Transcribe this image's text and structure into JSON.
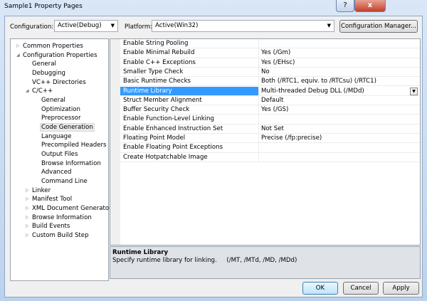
{
  "window": {
    "title": "Sample1 Property Pages",
    "help_glyph": "?",
    "close_glyph": "x"
  },
  "toolbar": {
    "configuration_label": "Configuration:",
    "configuration_value": "Active(Debug)",
    "platform_label": "Platform:",
    "platform_value": "Active(Win32)",
    "config_manager": "Configuration Manager..."
  },
  "tree": [
    {
      "label": "Common Properties",
      "level": 0,
      "expander": "collapsed"
    },
    {
      "label": "Configuration Properties",
      "level": 0,
      "expander": "expanded"
    },
    {
      "label": "General",
      "level": 1
    },
    {
      "label": "Debugging",
      "level": 1
    },
    {
      "label": "VC++ Directories",
      "level": 1
    },
    {
      "label": "C/C++",
      "level": 1,
      "expander": "expanded"
    },
    {
      "label": "General",
      "level": 2
    },
    {
      "label": "Optimization",
      "level": 2
    },
    {
      "label": "Preprocessor",
      "level": 2
    },
    {
      "label": "Code Generation",
      "level": 2,
      "selected": true
    },
    {
      "label": "Language",
      "level": 2
    },
    {
      "label": "Precompiled Headers",
      "level": 2
    },
    {
      "label": "Output Files",
      "level": 2
    },
    {
      "label": "Browse Information",
      "level": 2
    },
    {
      "label": "Advanced",
      "level": 2
    },
    {
      "label": "Command Line",
      "level": 2
    },
    {
      "label": "Linker",
      "level": 1,
      "expander": "collapsed"
    },
    {
      "label": "Manifest Tool",
      "level": 1,
      "expander": "collapsed"
    },
    {
      "label": "XML Document Generator",
      "level": 1,
      "expander": "collapsed"
    },
    {
      "label": "Browse Information",
      "level": 1,
      "expander": "collapsed"
    },
    {
      "label": "Build Events",
      "level": 1,
      "expander": "collapsed"
    },
    {
      "label": "Custom Build Step",
      "level": 1,
      "expander": "collapsed"
    }
  ],
  "properties": [
    {
      "name": "Enable String Pooling",
      "value": ""
    },
    {
      "name": "Enable Minimal Rebuild",
      "value": "Yes (/Gm)"
    },
    {
      "name": "Enable C++ Exceptions",
      "value": "Yes (/EHsc)"
    },
    {
      "name": "Smaller Type Check",
      "value": "No"
    },
    {
      "name": "Basic Runtime Checks",
      "value": "Both (/RTC1, equiv. to /RTCsu) (/RTC1)"
    },
    {
      "name": "Runtime Library",
      "value": "Multi-threaded Debug DLL (/MDd)",
      "selected": true
    },
    {
      "name": "Struct Member Alignment",
      "value": "Default"
    },
    {
      "name": "Buffer Security Check",
      "value": "Yes (/GS)"
    },
    {
      "name": "Enable Function-Level Linking",
      "value": ""
    },
    {
      "name": "Enable Enhanced Instruction Set",
      "value": "Not Set"
    },
    {
      "name": "Floating Point Model",
      "value": "Precise (/fp:precise)"
    },
    {
      "name": "Enable Floating Point Exceptions",
      "value": ""
    },
    {
      "name": "Create Hotpatchable Image",
      "value": ""
    }
  ],
  "description": {
    "title": "Runtime Library",
    "text": "Specify runtime library for linking.     (/MT, /MTd, /MD, /MDd)"
  },
  "buttons": {
    "ok": "OK",
    "cancel": "Cancel",
    "apply": "Apply"
  },
  "colors": {
    "selection": "#3399ff"
  }
}
